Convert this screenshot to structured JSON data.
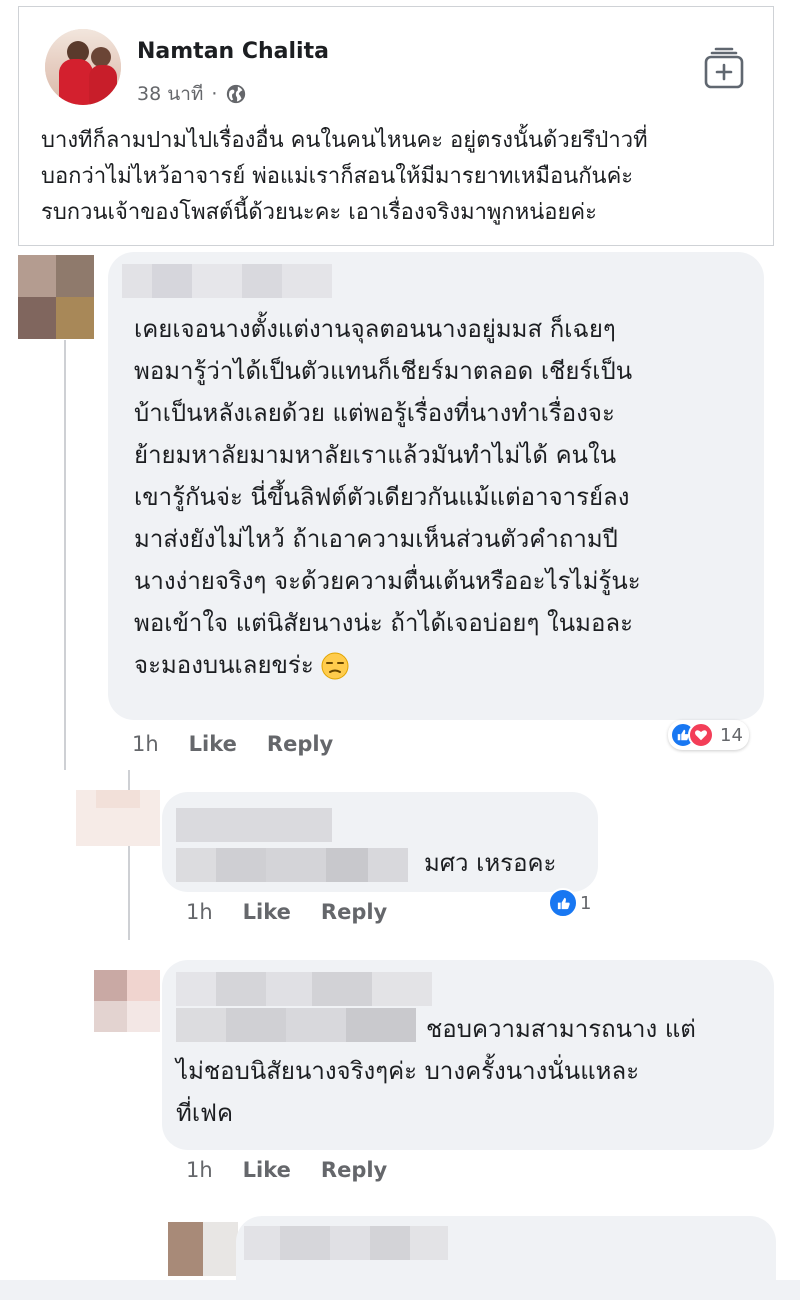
{
  "post": {
    "author": "Namtan Chalita",
    "time": "38 นาที",
    "separator": "·",
    "lines": [
      "บางทีก็ลามปามไปเรื่องอื่น คนในคนไหนคะ อยู่ตรงนั้นด้วยรึป่าวที่",
      "บอกว่าไม่ไหว้อาจารย์ พ่อแม่เราก็สอนให้มีมารยาทเหมือนกันค่ะ",
      "รบกวนเจ้าของโพสต์นี้ด้วยนะคะ เอาเรื่องจริงมาพูกหน่อยค่ะ"
    ]
  },
  "comments": [
    {
      "lines": [
        "เคยเจอนางตั้งแต่งานจุลตอนนางอยู่มมส ก็เฉยๆ",
        "พอมารู้ว่าได้เป็นตัวแทนก็เชียร์มาตลอด เชียร์เป็น",
        "บ้าเป็นหลังเลยด้วย แต่พอรู้เรื่องที่นางทำเรื่องจะ",
        "ย้ายมหาลัยมามหาลัยเราแล้วมันทำไม่ได้ คนใน",
        "เขารู้กันจ่ะ นี่ขึ้นลิฟต์ตัวเดียวกันแม้แต่อาจารย์ลง",
        "มาส่งยังไม่ไหว้ ถ้าเอาความเห็นส่วนตัวคำถามปี",
        "นางง่ายจริงๆ จะด้วยความตื่นเต้นหรืออะไรไม่รู้นะ",
        "พอเข้าใจ แต่นิสัยนางน่ะ ถ้าได้เจอบ่อยๆ ในมอละ",
        "จะมองบนเลยขร่ะ"
      ],
      "time": "1h",
      "like_label": "Like",
      "reply_label": "Reply",
      "reaction_count": "14"
    },
    {
      "lines": [
        "มศว เหรอคะ"
      ],
      "time": "1h",
      "like_label": "Like",
      "reply_label": "Reply",
      "reaction_count": "1"
    },
    {
      "lines": [
        "ชอบความสามารถนาง แต่",
        "ไม่ชอบนิสัยนางจริงๆค่ะ บางครั้งนางนั่นแหละ",
        "ที่เฟค"
      ],
      "time": "1h",
      "like_label": "Like",
      "reply_label": "Reply"
    }
  ],
  "colors": {
    "bubble": "#f0f2f5",
    "meta_text": "#65676b",
    "like_blue": "#1877f2",
    "love_red": "#f33e58"
  },
  "icons": [
    "globe-icon",
    "bookmark-add-icon",
    "like-reaction-icon",
    "love-reaction-icon",
    "unamused-face-emoji"
  ]
}
